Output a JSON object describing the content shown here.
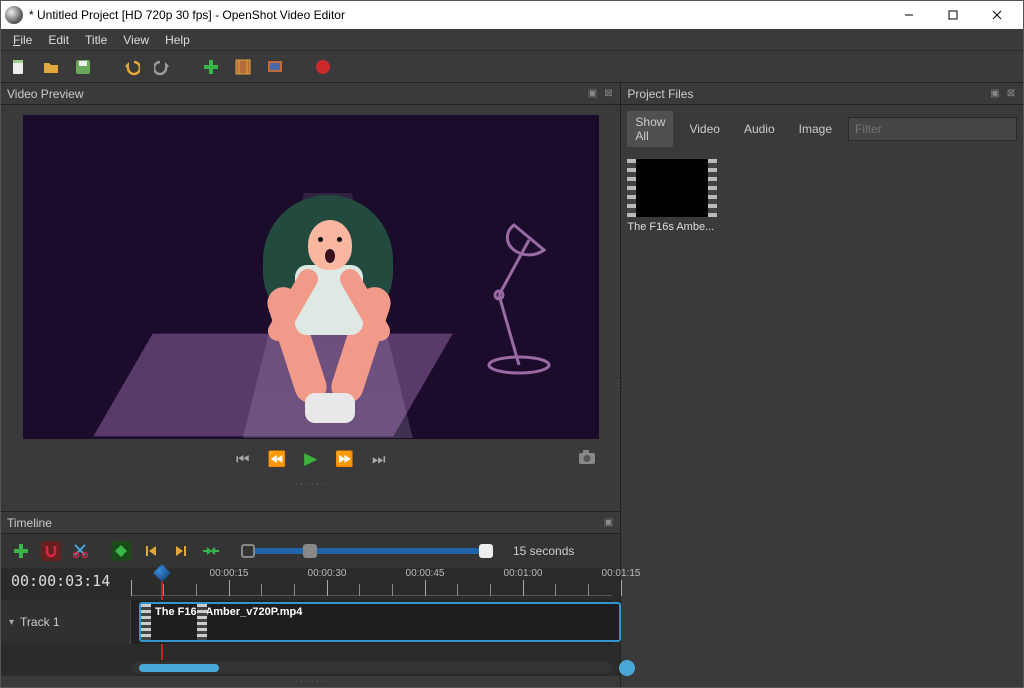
{
  "window": {
    "title": "* Untitled Project [HD 720p 30 fps] - OpenShot Video Editor"
  },
  "menu": {
    "file": "File",
    "edit": "Edit",
    "title": "Title",
    "view": "View",
    "help": "Help"
  },
  "panels": {
    "preview": "Video Preview",
    "project_files": "Project Files",
    "timeline": "Timeline"
  },
  "project_files": {
    "tabs": {
      "show_all": "Show All",
      "video": "Video",
      "audio": "Audio",
      "image": "Image"
    },
    "filter_placeholder": "Filter",
    "items": [
      {
        "name_display": "The F16s  Ambe..."
      }
    ]
  },
  "timeline": {
    "zoom_label": "15 seconds",
    "current_time": "00:00:03:14",
    "track1_label": "Track 1",
    "clip_label": "The F16s Amber_v720P.mp4",
    "ruler_marks": [
      "00:00:15",
      "00:00:30",
      "00:00:45",
      "00:01:00",
      "00:01:15"
    ]
  }
}
